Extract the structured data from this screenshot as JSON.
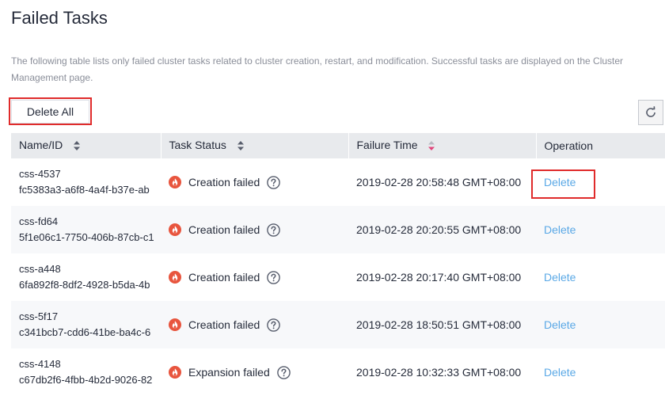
{
  "page": {
    "title": "Failed Tasks",
    "description": "The following table lists only failed cluster tasks related to cluster creation, restart, and modification. Successful tasks are displayed on the Cluster Management page."
  },
  "toolbar": {
    "delete_all_label": "Delete All",
    "refresh_icon": "refresh-icon"
  },
  "table": {
    "columns": [
      "Name/ID",
      "Task Status",
      "Failure Time",
      "Operation"
    ],
    "rows": [
      {
        "name": "css-4537",
        "id": "fc5383a3-a6f8-4a4f-b37e-ab",
        "status": "Creation failed",
        "time": "2019-02-28 20:58:48 GMT+08:00",
        "operation": "Delete"
      },
      {
        "name": "css-fd64",
        "id": "5f1e06c1-7750-406b-87cb-c1",
        "status": "Creation failed",
        "time": "2019-02-28 20:20:55 GMT+08:00",
        "operation": "Delete"
      },
      {
        "name": "css-a448",
        "id": "6fa892f8-8df2-4928-b5da-4b",
        "status": "Creation failed",
        "time": "2019-02-28 20:17:40 GMT+08:00",
        "operation": "Delete"
      },
      {
        "name": "css-5f17",
        "id": "c341bcb7-cdd6-41be-ba4c-6",
        "status": "Creation failed",
        "time": "2019-02-28 18:50:51 GMT+08:00",
        "operation": "Delete"
      },
      {
        "name": "css-4148",
        "id": "c67db2f6-4fbb-4b2d-9026-82",
        "status": "Expansion failed",
        "time": "2019-02-28 10:32:33 GMT+08:00",
        "operation": "Delete"
      }
    ]
  },
  "colors": {
    "failed_icon": "#e8553e",
    "link": "#5aa8e6",
    "highlight": "#e02b2b",
    "header_bg": "#e8eaed",
    "sort_active": "#e0457b"
  }
}
